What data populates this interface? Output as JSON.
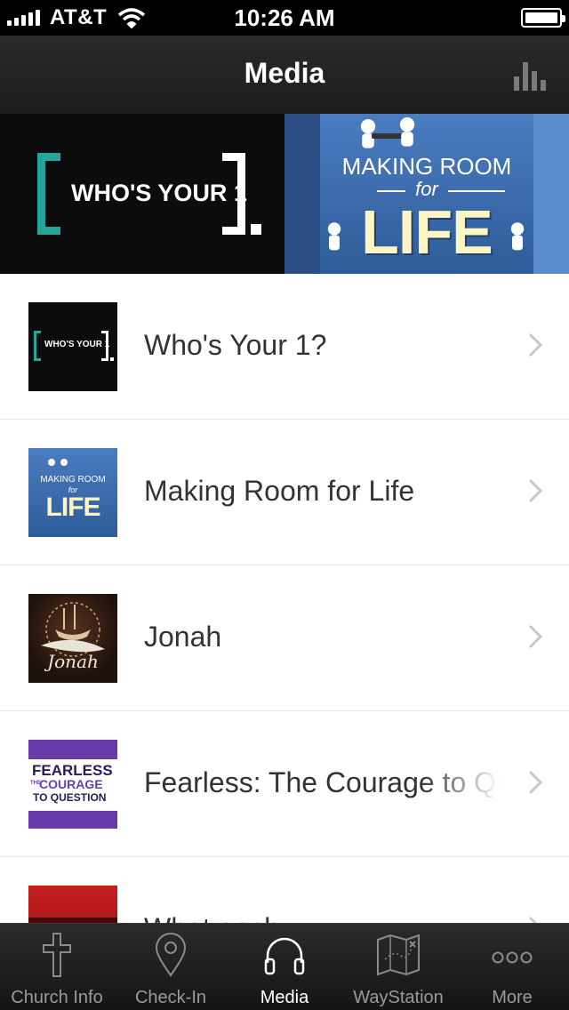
{
  "status_bar": {
    "carrier": "AT&T",
    "time": "10:26 AM"
  },
  "nav": {
    "title": "Media",
    "right_icon": "stats-bar-chart-icon"
  },
  "banner": {
    "slides": [
      {
        "title": "WHO'S YOUR 1"
      },
      {
        "line1": "MAKING ROOM",
        "line2": "for",
        "line3": "LIFE"
      }
    ]
  },
  "list": {
    "items": [
      {
        "label": "Who's Your 1?",
        "thumb_text": "WHO'S YOUR 1"
      },
      {
        "label": "Making Room for Life",
        "thumb_line1": "MAKING ROOM",
        "thumb_line2": "for",
        "thumb_line3": "LIFE"
      },
      {
        "label": "Jonah",
        "thumb_text": "Jonah"
      },
      {
        "label": "Fearless: The Courage to Question",
        "thumb_line1": "FEARLESS",
        "thumb_line2": "COURAGE",
        "thumb_line3": "TO QUESTION",
        "thumb_small": "THE"
      },
      {
        "label": "What each",
        "thumb_text": ""
      }
    ]
  },
  "tab_bar": {
    "tabs": [
      {
        "label": "Church Info",
        "icon": "cross-icon"
      },
      {
        "label": "Check-In",
        "icon": "location-pin-icon"
      },
      {
        "label": "Media",
        "icon": "headphones-icon",
        "active": true
      },
      {
        "label": "WayStation",
        "icon": "map-icon"
      },
      {
        "label": "More",
        "icon": "more-dots-icon"
      }
    ]
  },
  "colors": {
    "accent_teal": "#26a69a",
    "banner_blue": "#3a6fb0",
    "fearless_purple": "#6a3ba8",
    "tab_active": "#ffffff",
    "tab_inactive": "#9a9a9a"
  }
}
